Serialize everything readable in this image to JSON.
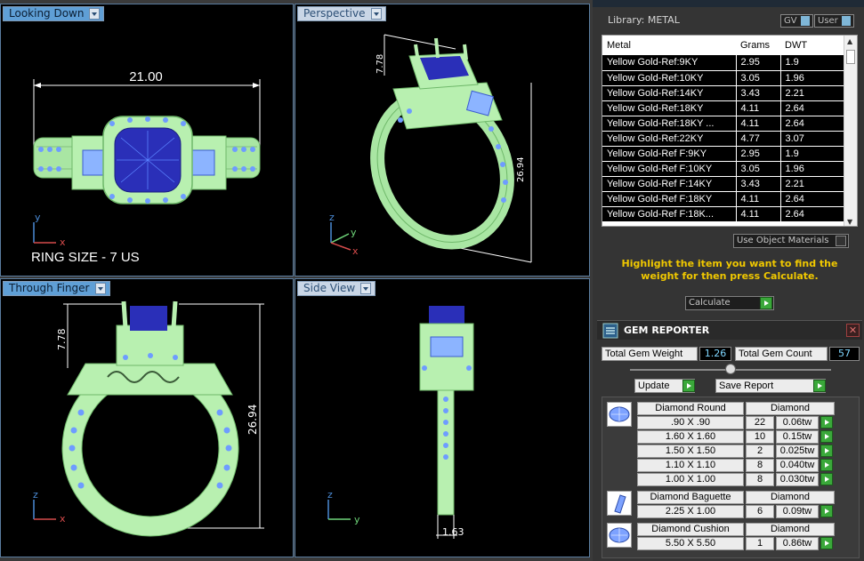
{
  "viewports": {
    "top_left": {
      "label": "Looking Down",
      "dim_width": "21.00",
      "ring_size": "RING SIZE - 7 US",
      "axis_a": "y",
      "axis_b": "x"
    },
    "top_right": {
      "label": "Perspective",
      "dim_a": "7.78",
      "dim_b": "26.94",
      "axis_a": "z",
      "axis_b": "y",
      "axis_c": "x"
    },
    "bottom_left": {
      "label": "Through Finger",
      "dim_a": "7.78",
      "dim_b": "26.94",
      "axis_a": "z",
      "axis_b": "x"
    },
    "bottom_right": {
      "label": "Side View",
      "dim_a": "1.63",
      "axis_a": "z",
      "axis_b": "y"
    }
  },
  "library": {
    "label": "Library: METAL",
    "gv_label": "GV",
    "user_label": "User",
    "columns": [
      "Metal",
      "Grams",
      "DWT"
    ],
    "rows": [
      [
        "Yellow Gold-Ref:9KY",
        "2.95",
        "1.9"
      ],
      [
        "Yellow Gold-Ref:10KY",
        "3.05",
        "1.96"
      ],
      [
        "Yellow Gold-Ref:14KY",
        "3.43",
        "2.21"
      ],
      [
        "Yellow Gold-Ref:18KY",
        "4.11",
        "2.64"
      ],
      [
        "Yellow Gold-Ref:18KY ...",
        "4.11",
        "2.64"
      ],
      [
        "Yellow Gold-Ref:22KY",
        "4.77",
        "3.07"
      ],
      [
        "Yellow Gold-Ref F:9KY",
        "2.95",
        "1.9"
      ],
      [
        "Yellow Gold-Ref F:10KY",
        "3.05",
        "1.96"
      ],
      [
        "Yellow Gold-Ref F:14KY",
        "3.43",
        "2.21"
      ],
      [
        "Yellow Gold-Ref F:18KY",
        "4.11",
        "2.64"
      ],
      [
        "Yellow Gold-Ref F:18K...",
        "4.11",
        "2.64"
      ]
    ],
    "use_object_materials": "Use Object Materials",
    "instruction": "Highlight the item you want to find the weight for then press Calculate.",
    "calculate": "Calculate"
  },
  "gem_reporter": {
    "title": "GEM REPORTER",
    "total_weight_label": "Total Gem Weight",
    "total_weight_value": "1.26",
    "total_count_label": "Total Gem Count",
    "total_count_value": "57",
    "update": "Update",
    "save_report": "Save Report",
    "groups": [
      {
        "name": "Diamond Round",
        "material": "Diamond",
        "rows": [
          [
            ".90 X .90",
            "22",
            "0.06tw"
          ],
          [
            "1.60 X 1.60",
            "10",
            "0.15tw"
          ],
          [
            "1.50 X 1.50",
            "2",
            "0.025tw"
          ],
          [
            "1.10 X 1.10",
            "8",
            "0.040tw"
          ],
          [
            "1.00 X 1.00",
            "8",
            "0.030tw"
          ]
        ]
      },
      {
        "name": "Diamond Baguette",
        "material": "Diamond",
        "rows": [
          [
            "2.25 X 1.00",
            "6",
            "0.09tw"
          ]
        ]
      },
      {
        "name": "Diamond Cushion",
        "material": "Diamond",
        "rows": [
          [
            "5.50 X 5.50",
            "1",
            "0.86tw"
          ]
        ]
      }
    ]
  },
  "colors": {
    "metal": "#b8f0b0",
    "stone": "#2a2fb8",
    "accent_stone": "#5a82ff",
    "highlight_text": "#f0c800"
  }
}
